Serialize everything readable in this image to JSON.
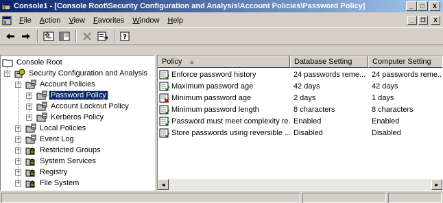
{
  "window": {
    "title": "Console1 - [Console Root\\Security Configuration and Analysis\\Account Policies\\Password Policy]",
    "minimize": "_",
    "maximize": "□",
    "close": "X"
  },
  "menu": {
    "items": [
      "File",
      "Action",
      "View",
      "Favorites",
      "Window",
      "Help"
    ],
    "mdi_min": "_",
    "mdi_restore": "❐",
    "mdi_close": "X"
  },
  "toolbar": {
    "buttons": [
      "back",
      "forward",
      "up-one-level",
      "show-hide-console-tree",
      "delete",
      "export-list",
      "help"
    ]
  },
  "tree": {
    "nodes": [
      {
        "label": "Console Root",
        "icon": "folder-icon",
        "level": 0,
        "expander": ""
      },
      {
        "label": "Security Configuration and Analysis",
        "icon": "security-config-icon",
        "level": 1,
        "expander": "−"
      },
      {
        "label": "Account Policies",
        "icon": "policy-folder-icon",
        "level": 2,
        "expander": "−"
      },
      {
        "label": "Password Policy",
        "icon": "policy-folder-icon",
        "level": 3,
        "expander": "+",
        "selected": true
      },
      {
        "label": "Account Lockout Policy",
        "icon": "policy-folder-icon",
        "level": 3,
        "expander": "+"
      },
      {
        "label": "Kerberos Policy",
        "icon": "policy-folder-icon",
        "level": 3,
        "expander": "+"
      },
      {
        "label": "Local Policies",
        "icon": "policy-folder-icon",
        "level": 2,
        "expander": "+"
      },
      {
        "label": "Event Log",
        "icon": "policy-folder-icon",
        "level": 2,
        "expander": "+"
      },
      {
        "label": "Restricted Groups",
        "icon": "lock-folder-icon",
        "level": 2,
        "expander": "+"
      },
      {
        "label": "System Services",
        "icon": "lock-folder-icon",
        "level": 2,
        "expander": "+"
      },
      {
        "label": "Registry",
        "icon": "lock-folder-icon",
        "level": 2,
        "expander": "+"
      },
      {
        "label": "File System",
        "icon": "lock-folder-icon",
        "level": 2,
        "expander": "+"
      }
    ]
  },
  "list": {
    "columns": [
      "Policy",
      "Database Setting",
      "Computer Setting"
    ],
    "sort_indicator": "▲",
    "rows": [
      {
        "policy": "Enforce password history",
        "database": "24 passwords reme...",
        "computer": "24 passwords reme...",
        "status": "match"
      },
      {
        "policy": "Maximum password age",
        "database": "42 days",
        "computer": "42 days",
        "status": "match"
      },
      {
        "policy": "Minimum password age",
        "database": "2 days",
        "computer": "1 days",
        "status": "mismatch"
      },
      {
        "policy": "Minimum password length",
        "database": "8 characters",
        "computer": "8 characters",
        "status": "match"
      },
      {
        "policy": "Password must meet complexity re...",
        "database": "Enabled",
        "computer": "Enabled",
        "status": "match"
      },
      {
        "policy": "Store passwords using reversible ...",
        "database": "Disabled",
        "computer": "Disabled",
        "status": "match"
      }
    ]
  },
  "scrollbar": {
    "left": "◄",
    "right": "►"
  },
  "colors": {
    "selection": "#0a246a",
    "titlebar_start": "#0a246a",
    "titlebar_end": "#a6caf0",
    "face": "#d4d0c8"
  }
}
